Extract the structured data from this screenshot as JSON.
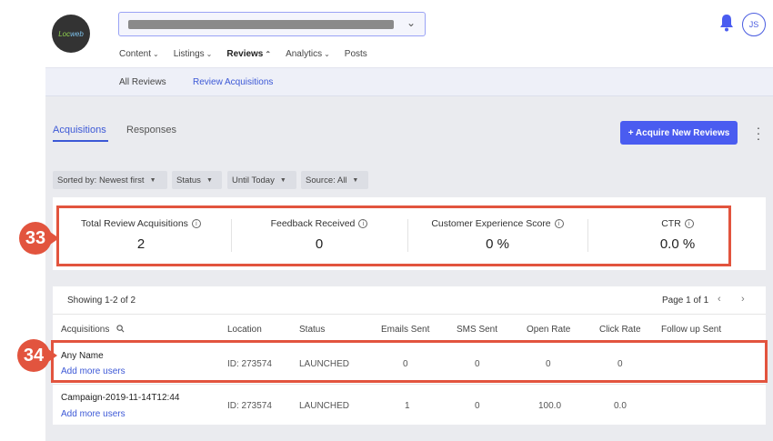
{
  "header": {
    "logo_text": "Loc",
    "logo_text2": "web",
    "location_chevron": "chevron-down-icon",
    "avatar_initials": "JS"
  },
  "nav": {
    "items": [
      {
        "label": "Content",
        "caret": "⌄"
      },
      {
        "label": "Listings",
        "caret": "⌄"
      },
      {
        "label": "Reviews",
        "caret": "⌃"
      },
      {
        "label": "Analytics",
        "caret": "⌄"
      },
      {
        "label": "Posts",
        "caret": ""
      }
    ]
  },
  "subnav": {
    "all_reviews": "All Reviews",
    "review_acquisitions": "Review Acquisitions"
  },
  "tabs": {
    "acquisitions": "Acquisitions",
    "responses": "Responses"
  },
  "actions": {
    "acquire_new": "+ Acquire New Reviews"
  },
  "filters": [
    {
      "label": "Sorted by: Newest first"
    },
    {
      "label": "Status"
    },
    {
      "label": "Until Today"
    },
    {
      "label": "Source: All"
    }
  ],
  "stats": [
    {
      "label": "Total Review Acquisitions",
      "value": "2"
    },
    {
      "label": "Feedback Received",
      "value": "0"
    },
    {
      "label": "Customer Experience Score",
      "value": "0 %"
    },
    {
      "label": "CTR",
      "value": "0.0 %"
    }
  ],
  "annotations": {
    "badge_33": "33",
    "badge_34": "34"
  },
  "table": {
    "showing": "Showing 1-2 of 2",
    "page": "Page 1 of 1",
    "prev": "‹",
    "next": "›",
    "columns": [
      "Acquisitions",
      "Location",
      "Status",
      "Emails Sent",
      "SMS Sent",
      "Open Rate",
      "Click Rate",
      "Follow up Sent"
    ],
    "rows": [
      {
        "name": "Any Name",
        "link": "Add more users",
        "location": "ID: 273574",
        "status": "LAUNCHED",
        "emails": "0",
        "sms": "0",
        "open_rate": "0",
        "click_rate": "0",
        "follow_up": ""
      },
      {
        "name": "Campaign-2019-11-14T12:44",
        "link": "Add more users",
        "location": "ID: 273574",
        "status": "LAUNCHED",
        "emails": "1",
        "sms": "0",
        "open_rate": "100.0",
        "click_rate": "0.0",
        "follow_up": ""
      }
    ]
  },
  "colors": {
    "accent": "#3c58d6",
    "button": "#4a5cf0",
    "highlight": "#e2543e"
  }
}
